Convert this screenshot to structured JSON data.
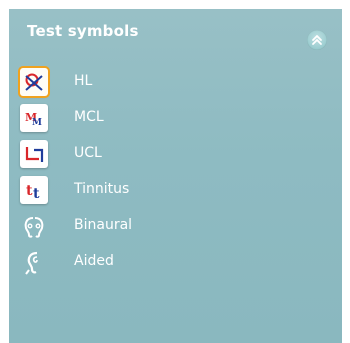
{
  "panel": {
    "title": "Test symbols",
    "collapse_icon": "double-chevron-up-icon"
  },
  "items": [
    {
      "label": "HL",
      "icon": "hl-symbol-icon",
      "selected": true
    },
    {
      "label": "MCL",
      "icon": "mcl-symbol-icon",
      "selected": false
    },
    {
      "label": "UCL",
      "icon": "ucl-symbol-icon",
      "selected": false
    },
    {
      "label": "Tinnitus",
      "icon": "tinnitus-symbol-icon",
      "selected": false
    },
    {
      "label": "Binaural",
      "icon": "binaural-ears-icon",
      "selected": false
    },
    {
      "label": "Aided",
      "icon": "aided-ear-icon",
      "selected": false
    }
  ],
  "colors": {
    "panel_bg": "#8ebbc2",
    "selected_border": "#f0a21e",
    "symbol_red": "#d9262a",
    "symbol_blue": "#1f3c9b"
  }
}
